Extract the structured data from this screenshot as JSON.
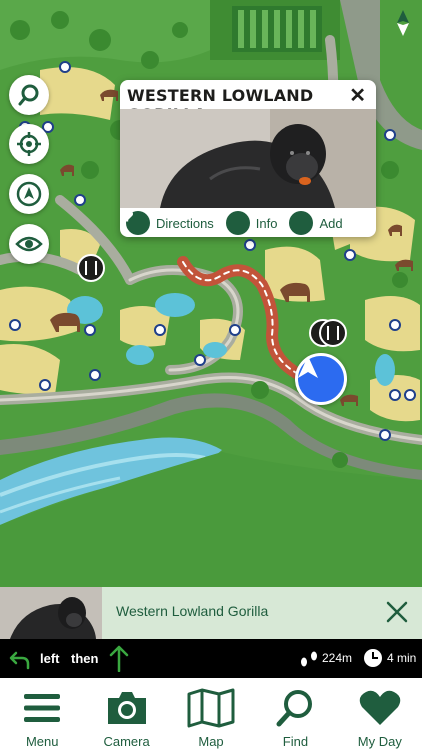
{
  "popup": {
    "title": "WESTERN LOWLAND GORILLA",
    "distance": "224m",
    "actions": [
      {
        "label": "Directions",
        "icon": "directions-icon"
      },
      {
        "label": "Info",
        "icon": "info-icon"
      },
      {
        "label": "Add",
        "icon": "heart-icon"
      }
    ]
  },
  "now_viewing": {
    "label": "Western Lowland Gorilla"
  },
  "directions": {
    "step1": "left",
    "step2": "then",
    "distance": "224m",
    "time": "4 min"
  },
  "tabs": [
    {
      "label": "Menu",
      "icon": "hamburger-icon"
    },
    {
      "label": "Camera",
      "icon": "camera-icon"
    },
    {
      "label": "Map",
      "icon": "map-icon"
    },
    {
      "label": "Find",
      "icon": "search-icon"
    },
    {
      "label": "My Day",
      "icon": "heart-icon"
    }
  ],
  "colors": {
    "brand_green": "#1f5d3e",
    "map_green": "#4a9a3c",
    "accent_orange": "#e8661f",
    "location_blue": "#2c6bf0",
    "route_red": "#c2543a"
  }
}
